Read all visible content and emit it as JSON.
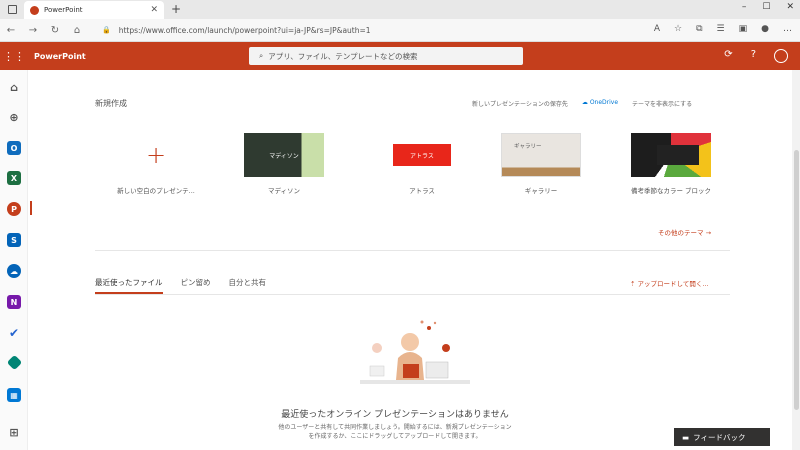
{
  "browser": {
    "tab_title": "PowerPoint",
    "tab_close": "✕",
    "new_tab": "+",
    "url_text": "https://www.office.com/launch/powerpoint?ui=ja-JP&rs=JP&auth=1",
    "window_controls": [
      "–",
      "☐",
      "✕"
    ]
  },
  "app": {
    "name": "PowerPoint",
    "search_placeholder": "アプリ、ファイル、テンプレートなどの検索",
    "right_icons": [
      "⟳",
      "?",
      ""
    ]
  },
  "rail": {
    "items": [
      {
        "icon": "home-icon",
        "color": "#ffffff"
      },
      {
        "icon": "create-icon",
        "color": "#ffffff"
      },
      {
        "icon": "outlook-icon",
        "color": "#0f6cbd"
      },
      {
        "icon": "excel-icon",
        "color": "#1d6f42"
      },
      {
        "icon": "powerpoint-icon",
        "color": "#c43e1c"
      },
      {
        "icon": "onenote-icon",
        "color": "#7719aa"
      },
      {
        "icon": "onedrive-icon",
        "color": "#0364b8"
      },
      {
        "icon": "forms-icon",
        "color": "#7719aa"
      },
      {
        "icon": "todo-icon",
        "color": "#2564cf"
      },
      {
        "icon": "sway-icon",
        "color": "#008575"
      },
      {
        "icon": "calendar-icon",
        "color": "#0078d4"
      },
      {
        "icon": "all-apps-icon",
        "color": "#666666"
      }
    ]
  },
  "new": {
    "title": "新規作成",
    "save_in": "新しいプレゼンテーションの保存先",
    "onedrive": "OneDrive",
    "hide_themes": "テーマを非表示にする",
    "templates": [
      {
        "label": "新しい空白のプレゼンテ..."
      },
      {
        "label": "マディソン",
        "thumb_text": "マディソン"
      },
      {
        "label": "アトラス",
        "thumb_text": "アトラス"
      },
      {
        "label": "ギャラリー",
        "thumb_text": "ギャラリー"
      },
      {
        "label": "備考季節なカラー ブロック"
      }
    ],
    "more_themes": "その他のテーマ →"
  },
  "files": {
    "tabs": [
      "最近使ったファイル",
      "ピン留め",
      "自分と共有"
    ],
    "upload": "⇡ アップロードして開く...",
    "empty_title": "最近使ったオンライン プレゼンテーションはありません",
    "empty_sub_1": "他のユーザーと共有して共同作業しましょう。開始するには、新規プレゼンテーション",
    "empty_sub_2": "を作成するか、ここにドラッグしてアップロードして開きます。"
  },
  "feedback": "フィードバック",
  "colors": {
    "brand": "#c43e1c",
    "feedback_bg": "#323130"
  }
}
